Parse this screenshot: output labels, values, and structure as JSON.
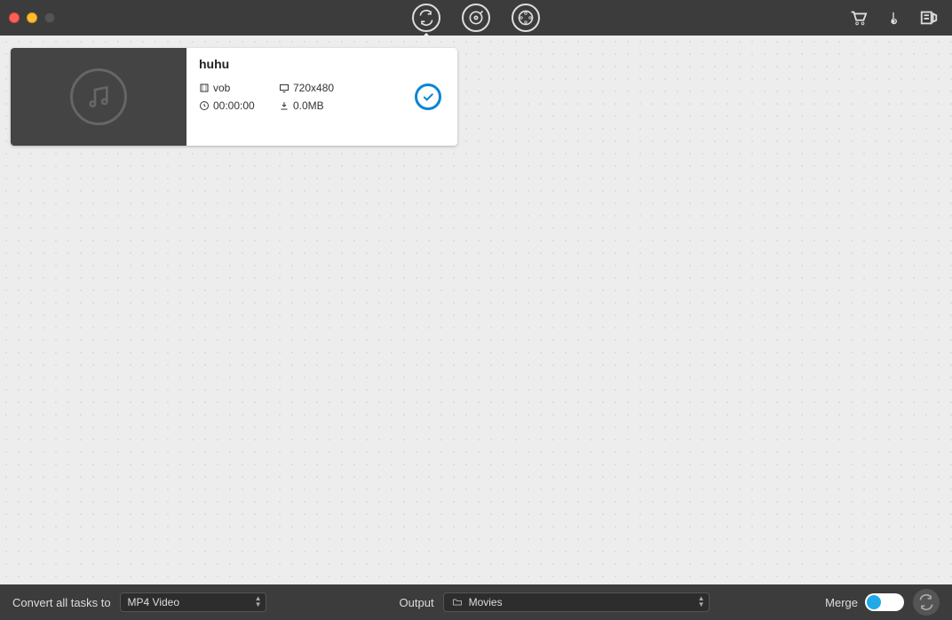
{
  "task": {
    "title": "huhu",
    "format": "vob",
    "resolution": "720x480",
    "duration": "00:00:00",
    "size": "0.0MB"
  },
  "bottom": {
    "convert_label": "Convert all tasks to",
    "convert_value": "MP4 Video",
    "output_label": "Output",
    "output_value": "Movies",
    "merge_label": "Merge"
  }
}
